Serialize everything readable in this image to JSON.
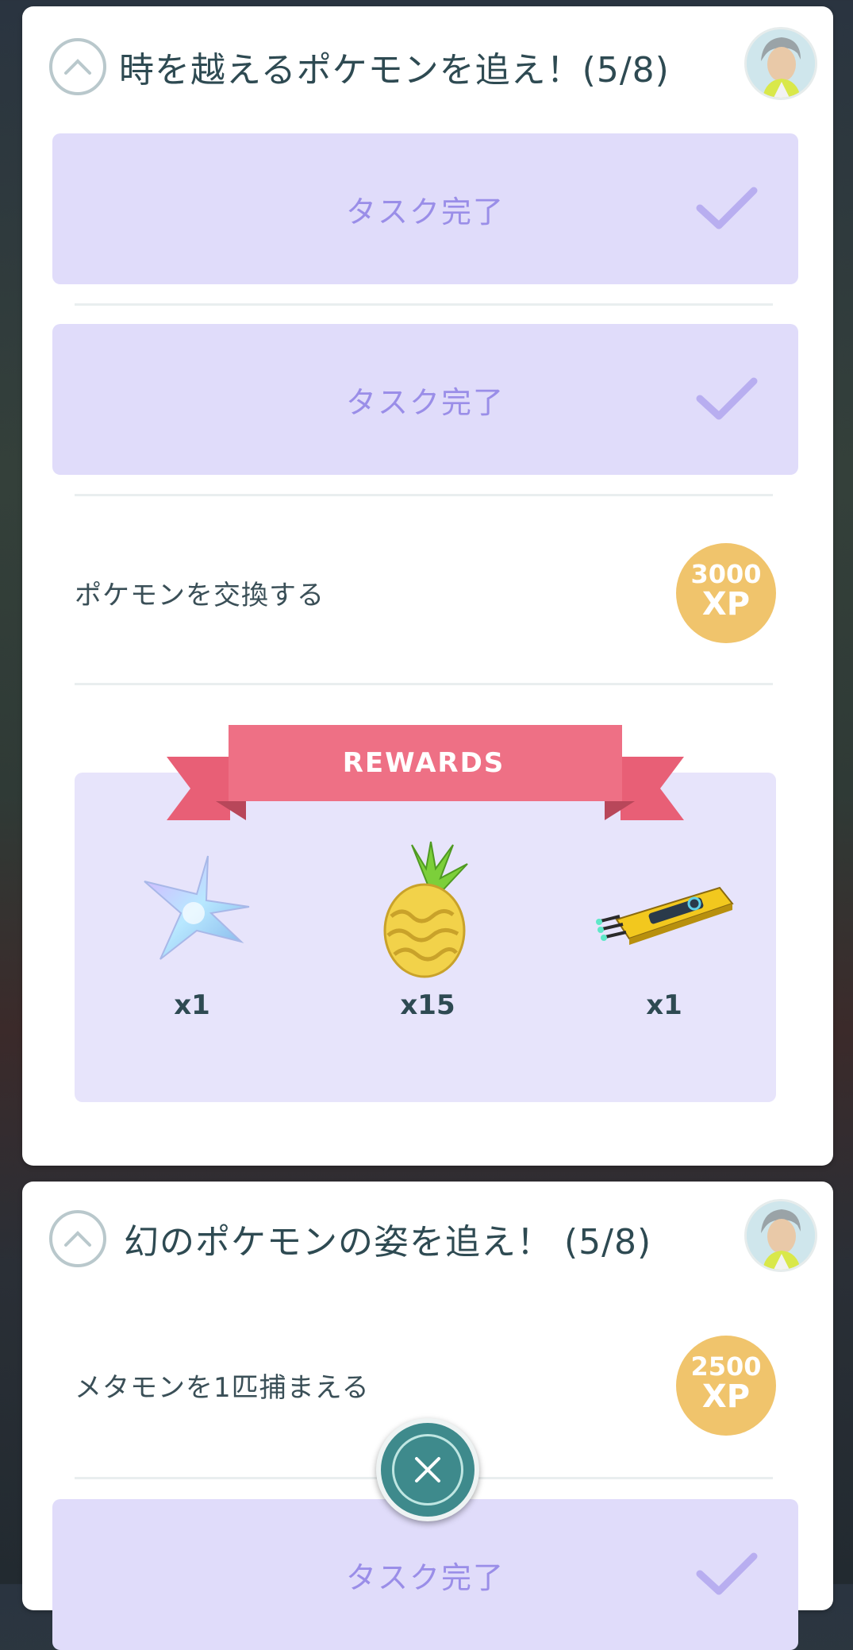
{
  "quest1": {
    "title": "時を越えるポケモンを追え！(5/8)",
    "tasks_done": [
      {
        "label": "タスク完了"
      },
      {
        "label": "タスク完了"
      }
    ],
    "active_task": {
      "text": "ポケモンを交換する",
      "xp_amount": "3000",
      "xp_unit": "XP"
    },
    "rewards": {
      "banner": "REWARDS",
      "items": [
        {
          "icon": "mega-energy-crystal-icon",
          "qty": "x1"
        },
        {
          "icon": "golden-pinap-berry-icon",
          "qty": "x15"
        },
        {
          "icon": "tm-charged-attack-icon",
          "qty": "x1"
        }
      ]
    }
  },
  "quest2": {
    "title": "幻のポケモンの姿を追え！ (5/8)",
    "active_task": {
      "text": "メタモンを1匹捕まえる",
      "xp_amount": "2500",
      "xp_unit": "XP"
    },
    "task_done": {
      "label": "タスク完了"
    }
  },
  "colors": {
    "task_done_bg": "#e0dcfa",
    "task_done_text": "#9a8ee8",
    "xp_badge": "#f0c46c",
    "ribbon": "#ee7085",
    "close_button": "#3e8a8c"
  }
}
